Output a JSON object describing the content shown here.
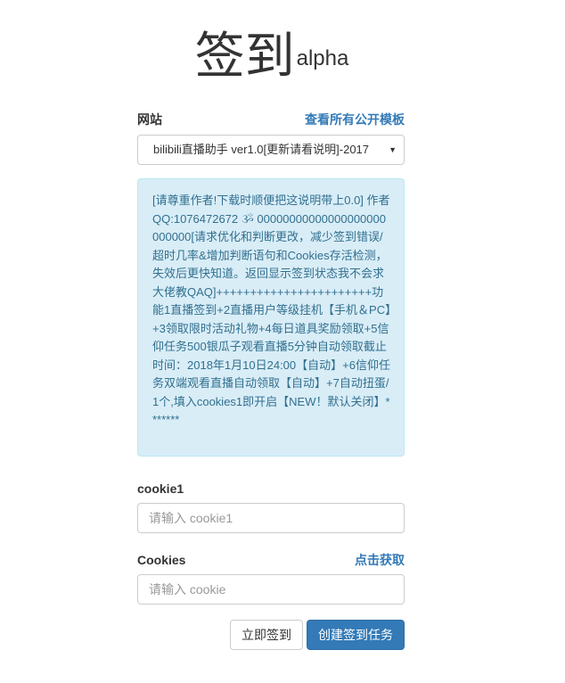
{
  "title": {
    "main": "签到",
    "sup": "alpha"
  },
  "site": {
    "label": "网站",
    "link": "查看所有公开模板",
    "selected": "bilibili直播助手 ver1.0[更新请看说明]-2017"
  },
  "info_text": "[请尊重作者!下载时顺便把这说明带上0.0] 作者QQ:1076472672 ૐ 00000000000000000000000000[请求优化和判断更改，减少签到错误/超时几率&增加判断语句和Cookies存活检测，失效后更快知道。返回显示签到状态我不会求大佬教QAQ]+++++++++++++++++++++++功能1直播签到+2直播用户等级挂机【手机＆PC】+3领取限时活动礼物+4每日道具奖励领取+5信仰任务500银瓜子观看直播5分钟自动领取截止时间：2018年1月10日24:00【自动】+6信仰任务双端观看直播自动领取【自动】+7自动扭蛋/1个,填入cookies1即开启【NEW！默认关闭】*******",
  "cookie1": {
    "label": "cookie1",
    "placeholder": "请输入 cookie1"
  },
  "cookies": {
    "label": "Cookies",
    "link": "点击获取",
    "placeholder": "请输入 cookie"
  },
  "buttons": {
    "sign_now": "立即签到",
    "create_task": "创建签到任务"
  }
}
